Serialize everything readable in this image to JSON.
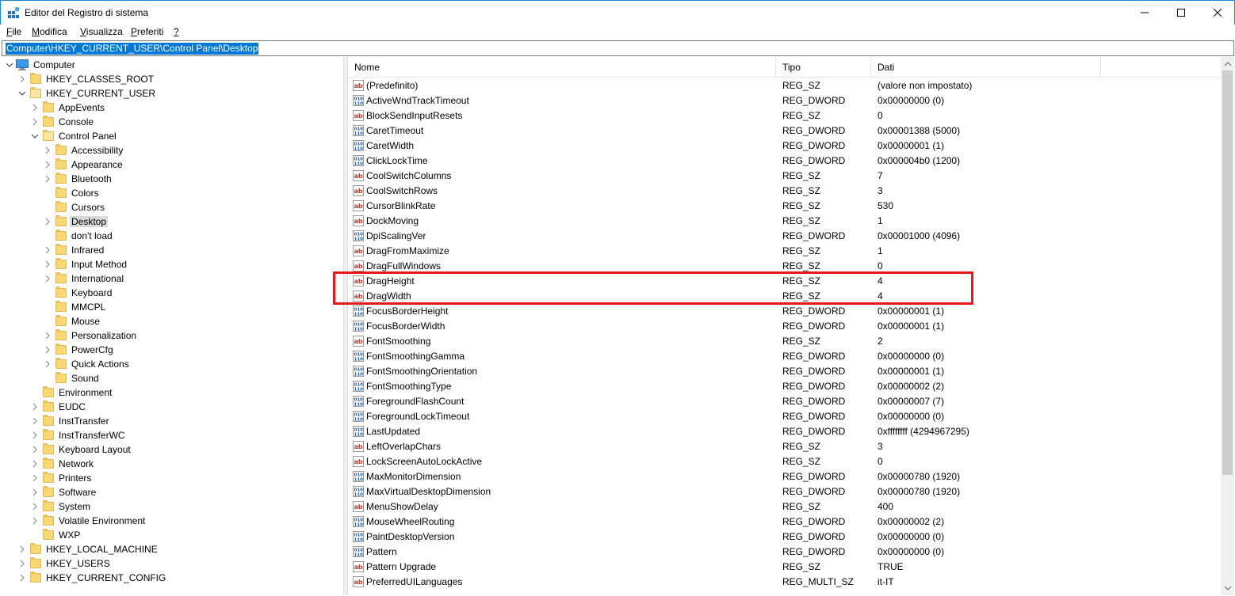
{
  "window": {
    "title": "Editor del Registro di sistema"
  },
  "menu": [
    {
      "label": "File",
      "ul": "F",
      "rest": "ile"
    },
    {
      "label": "Modifica",
      "ul": "M",
      "rest": "odifica"
    },
    {
      "label": "Visualizza",
      "ul": "V",
      "rest": "isualizza"
    },
    {
      "label": "Preferiti",
      "ul": "P",
      "rest": "referiti"
    },
    {
      "label": "?",
      "ul": "?",
      "rest": ""
    }
  ],
  "address": "Computer\\HKEY_CURRENT_USER\\Control Panel\\Desktop",
  "tree": [
    {
      "label": "Computer",
      "level": 0,
      "state": "expanded",
      "icon": "computer-icon"
    },
    {
      "label": "HKEY_CLASSES_ROOT",
      "level": 1,
      "state": "collapsed"
    },
    {
      "label": "HKEY_CURRENT_USER",
      "level": 1,
      "state": "expanded"
    },
    {
      "label": "AppEvents",
      "level": 2,
      "state": "collapsed"
    },
    {
      "label": "Console",
      "level": 2,
      "state": "collapsed"
    },
    {
      "label": "Control Panel",
      "level": 2,
      "state": "expanded"
    },
    {
      "label": "Accessibility",
      "level": 3,
      "state": "collapsed"
    },
    {
      "label": "Appearance",
      "level": 3,
      "state": "collapsed"
    },
    {
      "label": "Bluetooth",
      "level": 3,
      "state": "collapsed"
    },
    {
      "label": "Colors",
      "level": 3,
      "state": "none"
    },
    {
      "label": "Cursors",
      "level": 3,
      "state": "none"
    },
    {
      "label": "Desktop",
      "level": 3,
      "state": "collapsed",
      "selected": true
    },
    {
      "label": "don't load",
      "level": 3,
      "state": "none"
    },
    {
      "label": "Infrared",
      "level": 3,
      "state": "collapsed"
    },
    {
      "label": "Input Method",
      "level": 3,
      "state": "collapsed"
    },
    {
      "label": "International",
      "level": 3,
      "state": "collapsed"
    },
    {
      "label": "Keyboard",
      "level": 3,
      "state": "none"
    },
    {
      "label": "MMCPL",
      "level": 3,
      "state": "none"
    },
    {
      "label": "Mouse",
      "level": 3,
      "state": "none"
    },
    {
      "label": "Personalization",
      "level": 3,
      "state": "collapsed"
    },
    {
      "label": "PowerCfg",
      "level": 3,
      "state": "collapsed"
    },
    {
      "label": "Quick Actions",
      "level": 3,
      "state": "collapsed"
    },
    {
      "label": "Sound",
      "level": 3,
      "state": "none"
    },
    {
      "label": "Environment",
      "level": 2,
      "state": "none"
    },
    {
      "label": "EUDC",
      "level": 2,
      "state": "collapsed"
    },
    {
      "label": "InstTransfer",
      "level": 2,
      "state": "collapsed"
    },
    {
      "label": "InstTransferWC",
      "level": 2,
      "state": "collapsed"
    },
    {
      "label": "Keyboard Layout",
      "level": 2,
      "state": "collapsed"
    },
    {
      "label": "Network",
      "level": 2,
      "state": "collapsed"
    },
    {
      "label": "Printers",
      "level": 2,
      "state": "collapsed"
    },
    {
      "label": "Software",
      "level": 2,
      "state": "collapsed"
    },
    {
      "label": "System",
      "level": 2,
      "state": "collapsed"
    },
    {
      "label": "Volatile Environment",
      "level": 2,
      "state": "collapsed"
    },
    {
      "label": "WXP",
      "level": 2,
      "state": "none"
    },
    {
      "label": "HKEY_LOCAL_MACHINE",
      "level": 1,
      "state": "collapsed"
    },
    {
      "label": "HKEY_USERS",
      "level": 1,
      "state": "collapsed"
    },
    {
      "label": "HKEY_CURRENT_CONFIG",
      "level": 1,
      "state": "collapsed"
    }
  ],
  "columns": {
    "name": "Nome",
    "type": "Tipo",
    "data": "Dati"
  },
  "values": [
    {
      "name": "(Predefinito)",
      "type": "REG_SZ",
      "data": "(valore non impostato)",
      "icon": "string-value-icon"
    },
    {
      "name": "ActiveWndTrackTimeout",
      "type": "REG_DWORD",
      "data": "0x00000000 (0)",
      "icon": "binary-value-icon"
    },
    {
      "name": "BlockSendInputResets",
      "type": "REG_SZ",
      "data": "0",
      "icon": "string-value-icon"
    },
    {
      "name": "CaretTimeout",
      "type": "REG_DWORD",
      "data": "0x00001388 (5000)",
      "icon": "binary-value-icon"
    },
    {
      "name": "CaretWidth",
      "type": "REG_DWORD",
      "data": "0x00000001 (1)",
      "icon": "binary-value-icon"
    },
    {
      "name": "ClickLockTime",
      "type": "REG_DWORD",
      "data": "0x000004b0 (1200)",
      "icon": "binary-value-icon"
    },
    {
      "name": "CoolSwitchColumns",
      "type": "REG_SZ",
      "data": "7",
      "icon": "string-value-icon"
    },
    {
      "name": "CoolSwitchRows",
      "type": "REG_SZ",
      "data": "3",
      "icon": "string-value-icon"
    },
    {
      "name": "CursorBlinkRate",
      "type": "REG_SZ",
      "data": "530",
      "icon": "string-value-icon"
    },
    {
      "name": "DockMoving",
      "type": "REG_SZ",
      "data": "1",
      "icon": "string-value-icon"
    },
    {
      "name": "DpiScalingVer",
      "type": "REG_DWORD",
      "data": "0x00001000 (4096)",
      "icon": "binary-value-icon"
    },
    {
      "name": "DragFromMaximize",
      "type": "REG_SZ",
      "data": "1",
      "icon": "string-value-icon"
    },
    {
      "name": "DragFullWindows",
      "type": "REG_SZ",
      "data": "0",
      "icon": "string-value-icon"
    },
    {
      "name": "DragHeight",
      "type": "REG_SZ",
      "data": "4",
      "icon": "string-value-icon"
    },
    {
      "name": "DragWidth",
      "type": "REG_SZ",
      "data": "4",
      "icon": "string-value-icon"
    },
    {
      "name": "FocusBorderHeight",
      "type": "REG_DWORD",
      "data": "0x00000001 (1)",
      "icon": "binary-value-icon"
    },
    {
      "name": "FocusBorderWidth",
      "type": "REG_DWORD",
      "data": "0x00000001 (1)",
      "icon": "binary-value-icon"
    },
    {
      "name": "FontSmoothing",
      "type": "REG_SZ",
      "data": "2",
      "icon": "string-value-icon"
    },
    {
      "name": "FontSmoothingGamma",
      "type": "REG_DWORD",
      "data": "0x00000000 (0)",
      "icon": "binary-value-icon"
    },
    {
      "name": "FontSmoothingOrientation",
      "type": "REG_DWORD",
      "data": "0x00000001 (1)",
      "icon": "binary-value-icon"
    },
    {
      "name": "FontSmoothingType",
      "type": "REG_DWORD",
      "data": "0x00000002 (2)",
      "icon": "binary-value-icon"
    },
    {
      "name": "ForegroundFlashCount",
      "type": "REG_DWORD",
      "data": "0x00000007 (7)",
      "icon": "binary-value-icon"
    },
    {
      "name": "ForegroundLockTimeout",
      "type": "REG_DWORD",
      "data": "0x00000000 (0)",
      "icon": "binary-value-icon"
    },
    {
      "name": "LastUpdated",
      "type": "REG_DWORD",
      "data": "0xffffffff (4294967295)",
      "icon": "binary-value-icon"
    },
    {
      "name": "LeftOverlapChars",
      "type": "REG_SZ",
      "data": "3",
      "icon": "string-value-icon"
    },
    {
      "name": "LockScreenAutoLockActive",
      "type": "REG_SZ",
      "data": "0",
      "icon": "string-value-icon"
    },
    {
      "name": "MaxMonitorDimension",
      "type": "REG_DWORD",
      "data": "0x00000780 (1920)",
      "icon": "binary-value-icon"
    },
    {
      "name": "MaxVirtualDesktopDimension",
      "type": "REG_DWORD",
      "data": "0x00000780 (1920)",
      "icon": "binary-value-icon"
    },
    {
      "name": "MenuShowDelay",
      "type": "REG_SZ",
      "data": "400",
      "icon": "string-value-icon"
    },
    {
      "name": "MouseWheelRouting",
      "type": "REG_DWORD",
      "data": "0x00000002 (2)",
      "icon": "binary-value-icon"
    },
    {
      "name": "PaintDesktopVersion",
      "type": "REG_DWORD",
      "data": "0x00000000 (0)",
      "icon": "binary-value-icon"
    },
    {
      "name": "Pattern",
      "type": "REG_DWORD",
      "data": "0x00000000 (0)",
      "icon": "binary-value-icon"
    },
    {
      "name": "Pattern Upgrade",
      "type": "REG_SZ",
      "data": "TRUE",
      "icon": "string-value-icon"
    },
    {
      "name": "PreferredUILanguages",
      "type": "REG_MULTI_SZ",
      "data": "it-IT",
      "icon": "string-value-icon"
    }
  ],
  "highlight_color": "#e8171e",
  "accent_color": "#0078d7"
}
